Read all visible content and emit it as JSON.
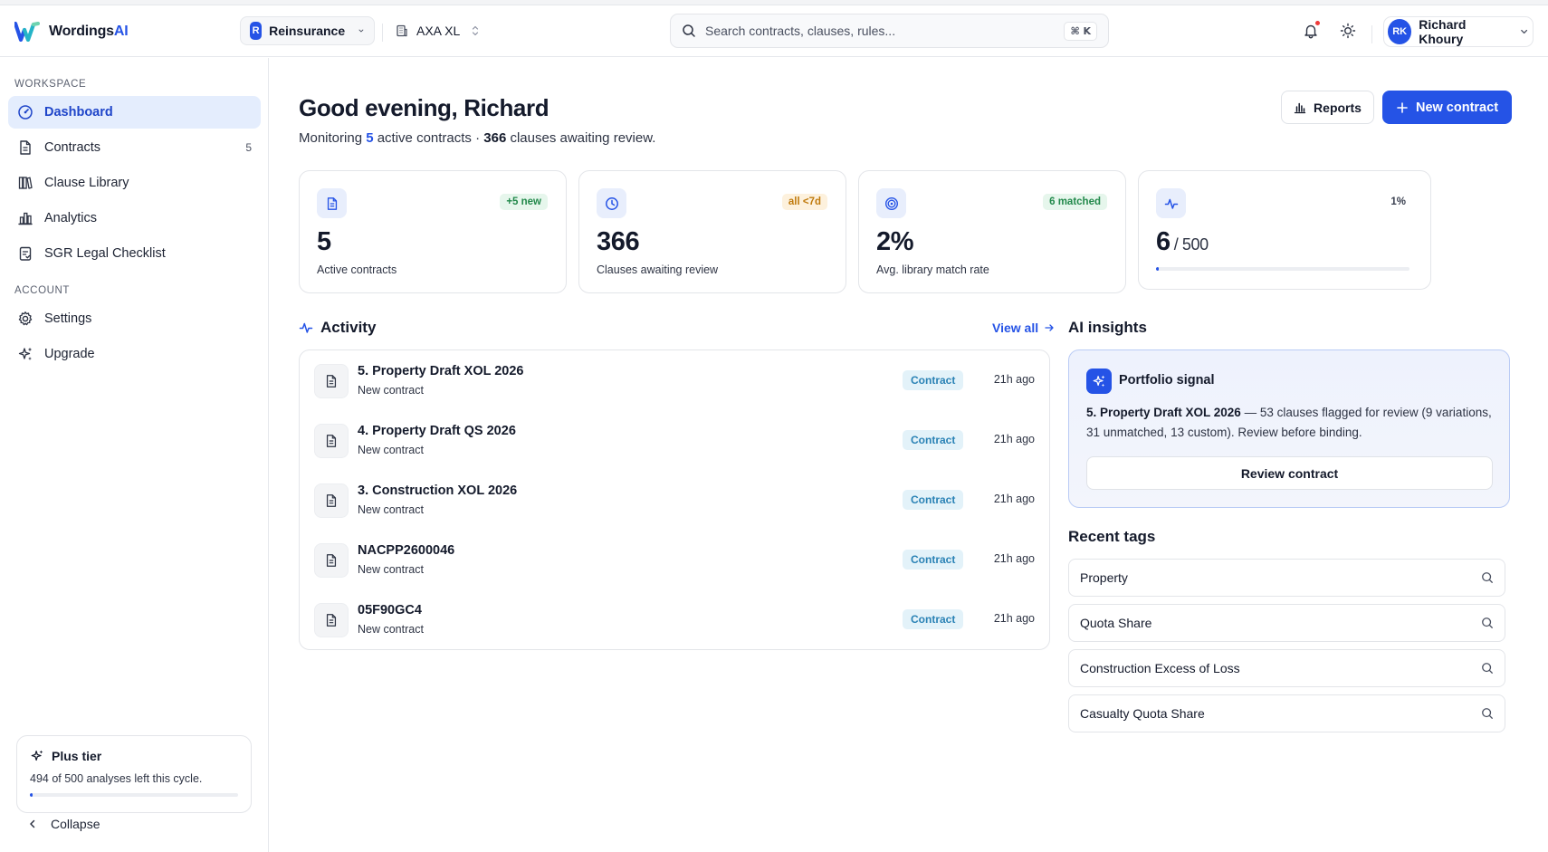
{
  "brand": {
    "name_main": "Wordings",
    "name_accent": "AI"
  },
  "topbar": {
    "workspace_initial": "R",
    "workspace_label": "Reinsurance",
    "org_label": "AXA XL",
    "search_placeholder": "Search contracts, clauses, rules...",
    "search_shortcut": "⌘ K",
    "user_initials": "RK",
    "user_name": "Richard Khoury"
  },
  "sidebar": {
    "workspace_label": "WORKSPACE",
    "account_label": "ACCOUNT",
    "items": [
      {
        "label": "Dashboard",
        "count": ""
      },
      {
        "label": "Contracts",
        "count": "5"
      },
      {
        "label": "Clause Library",
        "count": ""
      },
      {
        "label": "Analytics",
        "count": ""
      },
      {
        "label": "SGR Legal Checklist",
        "count": ""
      }
    ],
    "account_items": [
      {
        "label": "Settings"
      },
      {
        "label": "Upgrade"
      }
    ],
    "plan": {
      "title": "Plus tier",
      "subtitle": "494 of 500 analyses left this cycle.",
      "used_fraction": 0.012
    },
    "collapse_label": "Collapse"
  },
  "header": {
    "greeting": "Good evening, Richard",
    "sub_prefix": "Monitoring ",
    "sub_active": "5",
    "sub_mid": " active contracts · ",
    "sub_clauses": "366",
    "sub_suffix": " clauses awaiting review.",
    "reports_label": "Reports",
    "new_contract_label": "New contract"
  },
  "stats": [
    {
      "value": "5",
      "label": "Active contracts",
      "badge": "+5 new"
    },
    {
      "value": "366",
      "label": "Clauses awaiting review",
      "badge": "all <7d"
    },
    {
      "value": "2%",
      "label": "Avg. library match rate",
      "badge": "6 matched"
    },
    {
      "value": "6",
      "of": "/ 500",
      "badge": "1%",
      "progress_fraction": 0.012
    }
  ],
  "activity": {
    "title": "Activity",
    "view_all": "View all",
    "rows": [
      {
        "title": "5. Property Draft XOL 2026",
        "sub": "New contract",
        "pill": "Contract",
        "time": "21h ago"
      },
      {
        "title": "4. Property Draft QS 2026",
        "sub": "New contract",
        "pill": "Contract",
        "time": "21h ago"
      },
      {
        "title": "3. Construction XOL 2026",
        "sub": "New contract",
        "pill": "Contract",
        "time": "21h ago"
      },
      {
        "title": "NACPP2600046",
        "sub": "New contract",
        "pill": "Contract",
        "time": "21h ago"
      },
      {
        "title": "05F90GC4",
        "sub": "New contract",
        "pill": "Contract",
        "time": "21h ago"
      }
    ]
  },
  "insights": {
    "title": "AI insights",
    "card_title": "Portfolio signal",
    "text_bold": "5. Property Draft XOL 2026",
    "text_rest": " — 53 clauses flagged for review (9 variations, 31 unmatched, 13 custom). Review before binding.",
    "button_label": "Review contract"
  },
  "tags": {
    "title": "Recent tags",
    "items": [
      "Property",
      "Quota Share",
      "Construction Excess of Loss",
      "Casualty Quota Share"
    ]
  },
  "colors": {
    "accent": "#2553e6",
    "active_nav_bg": "#e4edfd",
    "badge_green": "#22894b",
    "badge_amber": "#c07a0c",
    "pill_blue": "#2a82b5",
    "notification_dot": "#ef3b3b"
  },
  "icons": {
    "dashboard": "gauge-icon",
    "contracts": "document-icon",
    "clause_library": "library-icon",
    "analytics": "bar-chart-icon",
    "checklist": "checklist-icon",
    "settings": "gear-icon",
    "upgrade": "sparkles-icon",
    "notifications": "bell-icon",
    "theme": "sun-icon",
    "reports": "bar-chart-icon",
    "new": "plus-icon",
    "activity": "pulse-icon",
    "insight": "sparkles-icon",
    "tag_search": "search-icon"
  }
}
